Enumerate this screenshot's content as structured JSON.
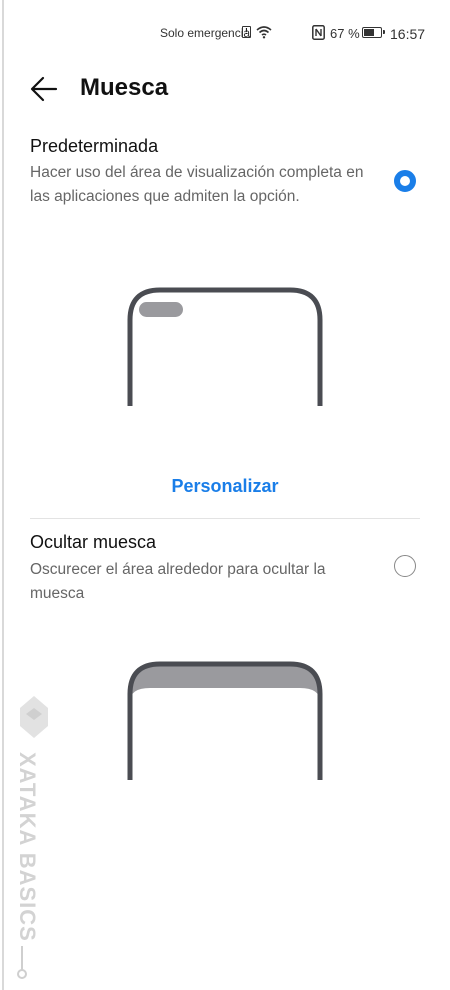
{
  "status_bar": {
    "emergency_text": "Solo emergencia",
    "battery_percent": "67 %",
    "battery_level": 0.67,
    "time": "16:57"
  },
  "header": {
    "title": "Muesca",
    "back_icon": "back-arrow-icon"
  },
  "options": [
    {
      "title": "Predeterminada",
      "description": "Hacer uso del área de visualización completa en las aplicaciones que admiten la opción.",
      "selected": true
    },
    {
      "title": "Ocultar muesca",
      "description": "Oscurecer el área alrededor para ocultar la muesca",
      "selected": false
    }
  ],
  "personalize_label": "Personalizar",
  "watermark": {
    "text": "XATAKA BASICS"
  },
  "colors": {
    "accent": "#1a7ee8",
    "phone_frame": "#4a4c52",
    "notch_fill": "#9a9a9e"
  }
}
